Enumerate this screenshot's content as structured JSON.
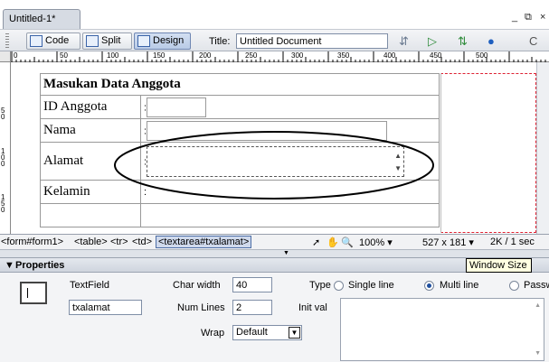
{
  "document": {
    "tab_title": "Untitled-1*",
    "window_controls": "_ ⊟ ×"
  },
  "toolbar": {
    "code_label": "Code",
    "split_label": "Split",
    "design_label": "Design",
    "title_label": "Title:",
    "title_value": "Untitled Document"
  },
  "ruler": {
    "h_marks": [
      "0",
      "50",
      "100",
      "150",
      "200",
      "250",
      "300",
      "350",
      "400",
      "450",
      "500"
    ],
    "v_marks": [
      "5\n0",
      "1\n0\n0",
      "1\n5\n0"
    ]
  },
  "form": {
    "heading": "Masukan Data Anggota",
    "colon": ":",
    "rows": [
      {
        "label": "ID Anggota"
      },
      {
        "label": "Nama"
      },
      {
        "label": "Alamat"
      },
      {
        "label": "Kelamin"
      }
    ]
  },
  "statusbar": {
    "tags": [
      "<form#form1>",
      "<table>",
      "<tr>",
      "<td>",
      "<textarea#txalamat>"
    ],
    "zoom": "100%",
    "window_size": "527 x 181",
    "download": "2K / 1 sec"
  },
  "properties": {
    "title": "Properties",
    "tooltip": "Window Size",
    "element_type": "TextField",
    "element_name": "txalamat",
    "char_width_label": "Char width",
    "char_width_value": "40",
    "num_lines_label": "Num Lines",
    "num_lines_value": "2",
    "wrap_label": "Wrap",
    "wrap_value": "Default",
    "type_label": "Type",
    "type_options": [
      "Single line",
      "Multi line",
      "Passw"
    ],
    "type_selected": "Multi line",
    "init_val_label": "Init val"
  },
  "colors": {
    "accent": "#3a63a8",
    "tooltip_bg": "#ffffe1",
    "annotation_ellipse": "#000000"
  }
}
